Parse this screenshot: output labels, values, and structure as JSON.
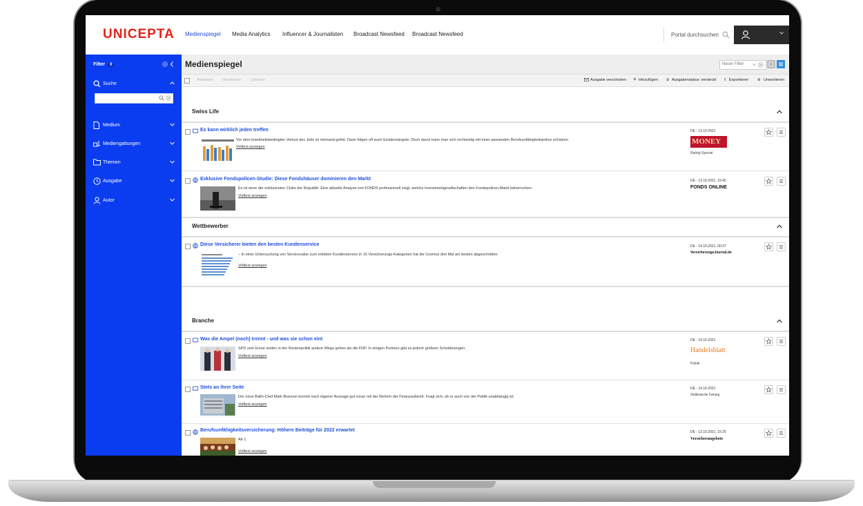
{
  "app": {
    "logo": "UNICEPTA",
    "nav": [
      "Medienspiegel",
      "Media Analytics",
      "Influencer & Journalisten",
      "Broadcast Newsfeed",
      "Broadcast Newsfeed"
    ],
    "active_nav": "Medienspiegel",
    "search_placeholder": "Portal durchsuchen"
  },
  "sidebar": {
    "filter_label": "Filter",
    "filter_count": "0",
    "search_label": "Suche",
    "items": [
      "Medium",
      "Mediengattungen",
      "Themen",
      "Ausgabe",
      "Autor"
    ]
  },
  "main": {
    "title": "Medienspiegel",
    "filter_placeholder": "Neuer Filter",
    "toolbar_disabled": [
      "Aktivieren",
      "Verstecken",
      "Löschen"
    ],
    "toolbar_enabled": [
      "Ausgabe verschicken",
      "Hinzufügen",
      "Ausgabenstatus: versteckt",
      "Exportieren",
      "Umsortieren"
    ]
  },
  "sections": [
    {
      "name": "Swiss Life"
    },
    {
      "name": "Wettbewerber"
    },
    {
      "name": "Branche"
    }
  ],
  "articles": [
    {
      "title": "Es kann wirklich jeden treffen",
      "text": "Vor dem krankheitsbedingten Verlust des Jobs ist niemand gefeit. Dann folgen oft auch Existenzängste. Doch davor kann man sich rechtzeitig mit einer passenden Berufsunfähigkeitspolice schützen",
      "link": "Volltext anzeigen",
      "meta": "DE - 13.10.2021",
      "sub": "Rating-Spezial",
      "publication": "MONEY"
    },
    {
      "title": "Exklusive Fondspolicen-Studie: Diese Fondshäuser dominieren den Markt",
      "text": "Es ist einer der exklusivsten Clubs der Republik: Eine aktuelle Analyse von FONDS professionell zeigt, welche Investmentgesellschaften den Fondspolicen-Markt beherrschen.",
      "link": "Volltext anzeigen",
      "meta": "DE - 13.10.2021, 15:42",
      "sub": "",
      "publication": "FONDS ONLINE"
    },
    {
      "title": "Diese Versicherer bieten den besten Kundenservice",
      "text": "– In einer Untersuchung von Servicevalue zum erlebten Kundenservice in 15 Versicherungs-Kategorien hat die Cosmos drei Mal am besten abgeschnitten.",
      "link": "Volltext anzeigen",
      "meta": "DE - 14.10.2021, 00:27",
      "sub": "",
      "publication": "VersicherungsJournal.de"
    },
    {
      "title": "Was die Ampel (noch) trennt - und was sie schon eint",
      "text": "SPD und Grüne wollen in der Rentenpolitik andere Wege gehen als die FDP. In einigen Punkten gibt es jedoch größere Schnittmengen.",
      "link": "Volltext anzeigen",
      "meta": "DE - 14.10.2021",
      "sub": "Politik",
      "publication": "Handelsblatt"
    },
    {
      "title": "Stets an ihrer Seite",
      "text": "Der neue Bafin-Chef Mark Branson kommt nach eigener Aussage gut voran mit der Reform der Finanzaufsicht. Fragt sich, ob er auch von der Politik unabhängig ist.",
      "link": "Volltext anzeigen",
      "meta": "DE - 14.10.2021",
      "sub": "",
      "publication": "Süddeutsche Zeitung"
    },
    {
      "title": "Berufsunfähigkeitsversicherung: Höhere Beiträge für 2022 erwartet",
      "text": "Ab 1.",
      "link": "Volltext anzeigen",
      "meta": "DE - 13.10.2021, 15:25",
      "sub": "",
      "publication": "Versicherungsbote"
    }
  ],
  "colors": {
    "brand_red": "#e2231a",
    "sidebar_blue": "#0a3cf0",
    "link_blue": "#1f4fe0"
  }
}
